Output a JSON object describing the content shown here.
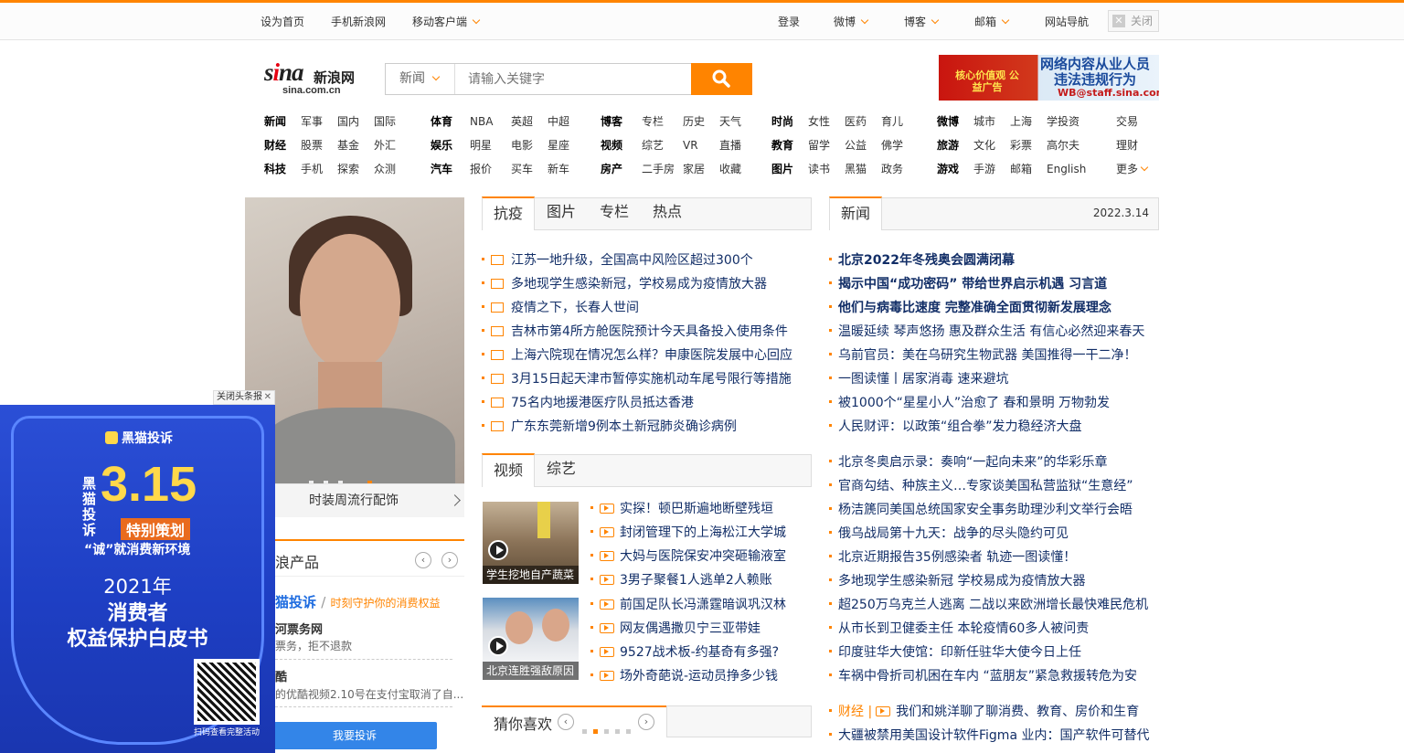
{
  "topbar": {
    "set_home": "设为首页",
    "mobile_sina": "手机新浪网",
    "mobile_client": "移动客户端",
    "login": "登录",
    "weibo": "微博",
    "blog": "博客",
    "mail": "邮箱",
    "site_nav": "网站导航",
    "close": "关闭"
  },
  "logo": {
    "en": "sina",
    "cn": "新浪网",
    "domain": "sina.com.cn"
  },
  "search": {
    "category": "新闻",
    "placeholder": "请输入关键字"
  },
  "top_ad": {
    "left": "核心价值观 公益广告",
    "line1": "网络内容从业人员",
    "line2": "违法违规行为",
    "line3": "WB@staff.sina.com"
  },
  "nav": {
    "g1": [
      [
        "新闻",
        "军事",
        "国内",
        "国际"
      ],
      [
        "财经",
        "股票",
        "基金",
        "外汇"
      ],
      [
        "科技",
        "手机",
        "探索",
        "众测"
      ]
    ],
    "g2": [
      [
        "体育",
        "NBA",
        "英超",
        "中超"
      ],
      [
        "娱乐",
        "明星",
        "电影",
        "星座"
      ],
      [
        "汽车",
        "报价",
        "买车",
        "新车"
      ]
    ],
    "g3": [
      [
        "博客",
        "专栏",
        "历史",
        "天气"
      ],
      [
        "视频",
        "综艺",
        "VR",
        "直播"
      ],
      [
        "房产",
        "二手房",
        "家居",
        "收藏"
      ]
    ],
    "g4": [
      [
        "时尚",
        "女性",
        "医药",
        "育儿"
      ],
      [
        "教育",
        "留学",
        "公益",
        "佛学"
      ],
      [
        "图片",
        "读书",
        "黑猫",
        "政务"
      ]
    ],
    "g5": [
      [
        "微博",
        "城市",
        "上海",
        "学投资"
      ],
      [
        "旅游",
        "文化",
        "彩票",
        "高尔夫"
      ],
      [
        "游戏",
        "手游",
        "邮箱",
        "English"
      ]
    ],
    "g6": [
      "交易",
      "理财",
      "更多"
    ]
  },
  "carousel": {
    "caption": "时装周流行配饰"
  },
  "tabs1": [
    "抗疫",
    "图片",
    "专栏",
    "热点"
  ],
  "news1": [
    "江苏一地升级，全国高中风险区超过300个",
    "多地现学生感染新冠，学校易成为疫情放大器",
    "疫情之下，长春人世间",
    "吉林市第4所方舱医院预计今天具备投入使用条件",
    "上海六院现在情况怎么样？申康医院发展中心回应",
    "3月15日起天津市暂停实施机动车尾号限行等措施",
    "75名内地援港医疗队员抵达香港",
    "广东东莞新增9例本土新冠肺炎确诊病例"
  ],
  "tabs2": [
    "视频",
    "综艺"
  ],
  "videos": [
    {
      "caption": "学生挖地自产蔬菜"
    },
    {
      "caption": "北京连胜强敌原因"
    }
  ],
  "video_list": [
    "实探！顿巴斯遍地断壁残垣",
    "封闭管理下的上海松江大学城",
    "大妈与医院保安冲突砸输液室",
    "3男子聚餐1人逃单2人赖账",
    "前国足队长冯潇霆暗讽巩汉林",
    "网友偶遇撒贝宁三亚带娃",
    "9527战术板-约基奇有多强?",
    "场外奇葩说-运动员挣多少钱"
  ],
  "guess": {
    "title": "猜你喜欢"
  },
  "news_panel": {
    "tab": "新闻",
    "date": "2022.3.14"
  },
  "news_bold": [
    "北京2022年冬残奥会圆满闭幕",
    "揭示中国“成功密码” 带给世界启示机遇 习言道",
    "他们与病毒比速度 完整准确全面贯彻新发展理念"
  ],
  "news_a": [
    "温暖延续 琴声悠扬 惠及群众生活 有信心必然迎来春天",
    "乌前官员：美在乌研究生物武器 美国推得一干二净！",
    "一图读懂丨居家消毒 速来避坑",
    "被1000个“星星小人”治愈了 春和景明 万物勃发",
    "人民财评：以政策“组合拳”发力稳经济大盘"
  ],
  "news_b": [
    "北京冬奥启示录：奏响“一起向未来”的华彩乐章",
    "官商勾结、种族主义…专家谈美国私营监狱“生意经”",
    "杨洁篪同美国总统国家安全事务助理沙利文举行会晤",
    "俄乌战局第十九天：战争的尽头隐约可见",
    "北京近期报告35例感染者 轨迹一图读懂！",
    "多地现学生感染新冠 学校易成为疫情放大器",
    "超250万乌克兰人逃离 二战以来欧洲增长最快难民危机",
    "从市长到卫健委主任 本轮疫情60多人被问责",
    "印度驻华大使馆：印新任驻华大使今日上任",
    "车祸中骨折司机困在车内 “蓝朋友”紧急救援转危为安"
  ],
  "finance": {
    "label": "财经 |",
    "text": "我们和姚洋聊了聊消费、教育、房价和生育"
  },
  "last_news": "大疆被禁用美国设计软件Figma 业内：国产软件可替代",
  "products": {
    "title": "浪产品",
    "heimao": "猫投诉",
    "heimao_slogan": "时刻守护你的消费权益",
    "item1_title": "河票务网",
    "item1_desc": "票务，拒不退款",
    "item2_title": "酷",
    "item2_desc": "的优酷视频2.10号在支付宝取消了自...",
    "complain_btn": "我要投诉"
  },
  "popup_ad": {
    "close_label": "关闭头条报",
    "brand": "黑猫投诉",
    "side_text": "黑猫投诉",
    "big": "3.15",
    "special": "特别策划",
    "slogan": "“诚”就消费新环境",
    "year": "2021年",
    "line2": "消费者",
    "line3": "权益保护白皮书",
    "scan": "扫码查看完整活动"
  }
}
